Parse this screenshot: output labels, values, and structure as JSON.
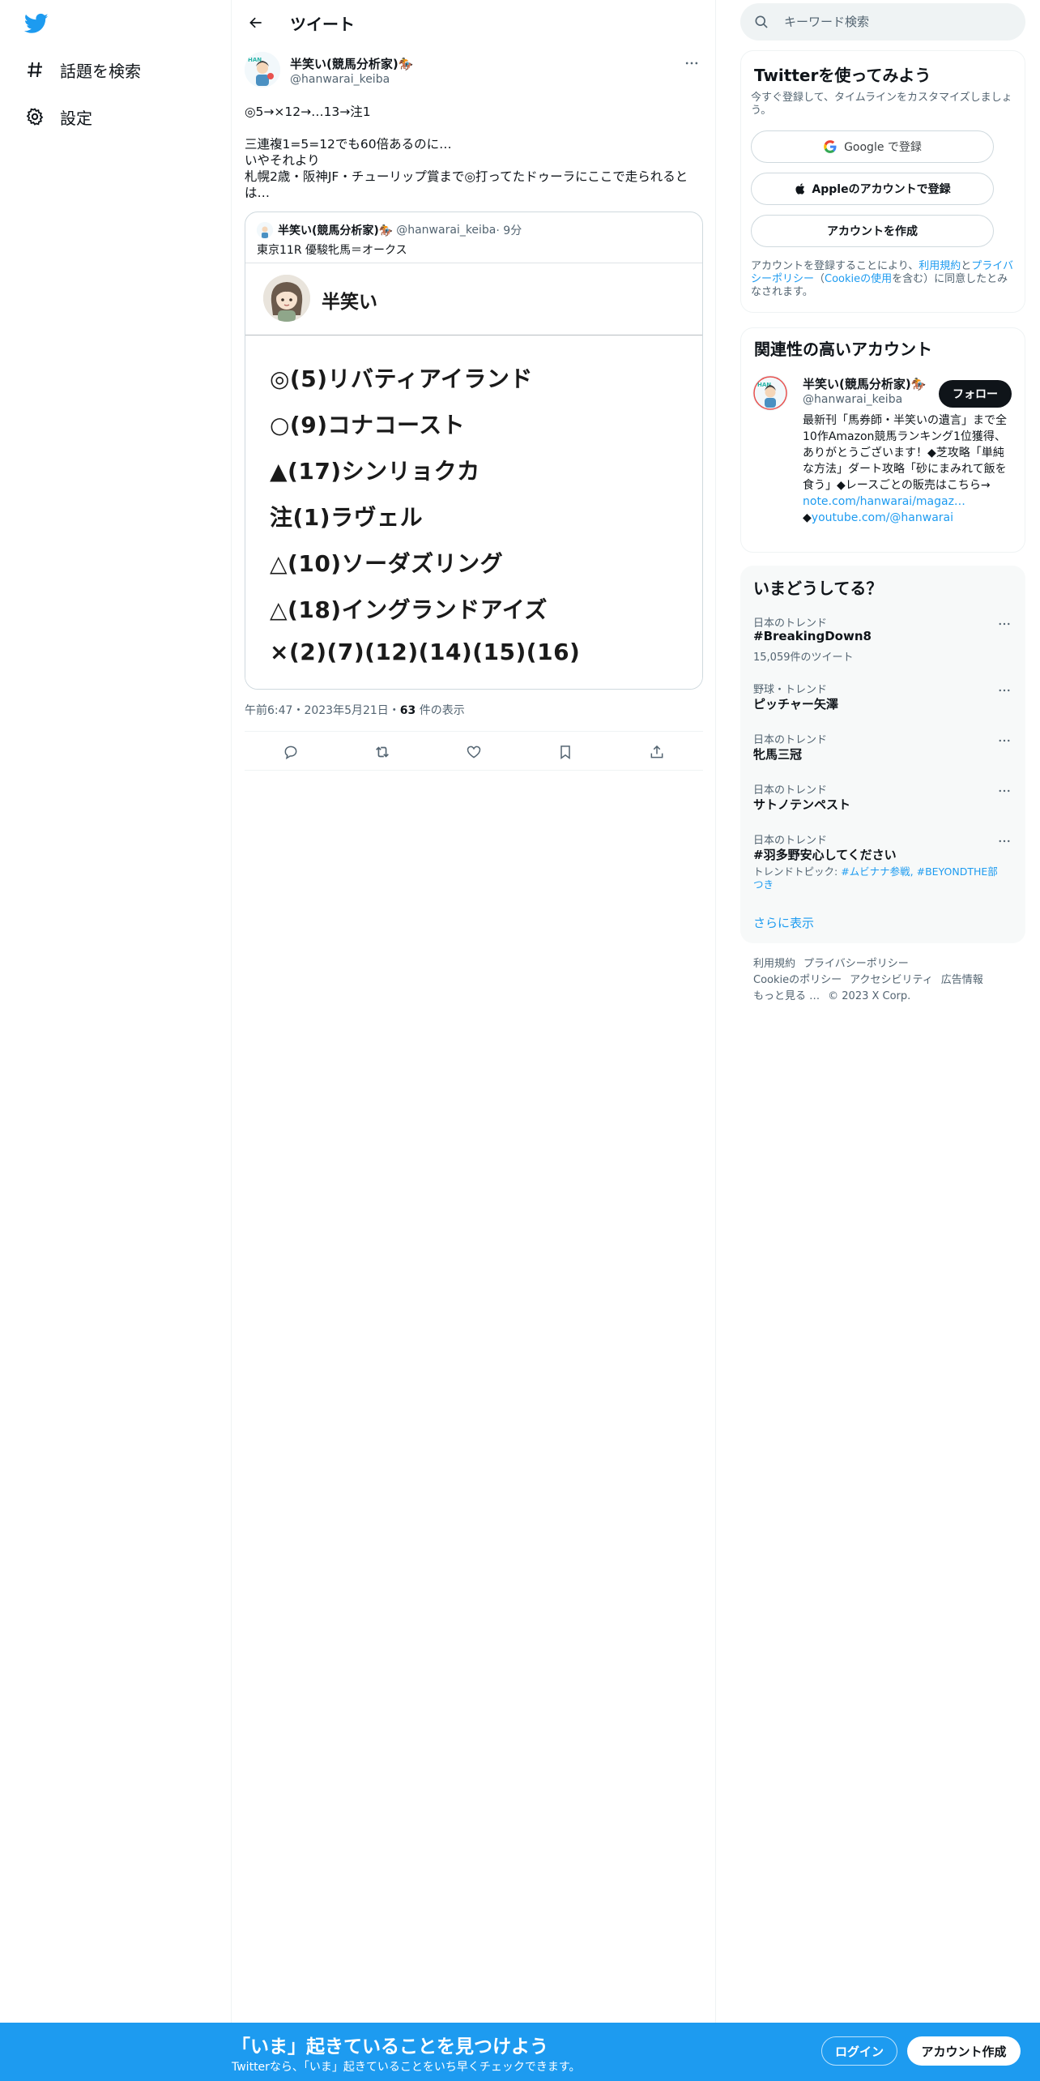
{
  "sidebar": {
    "items": [
      {
        "label": "話題を検索",
        "icon": "hashtag-icon"
      },
      {
        "label": "設定",
        "icon": "gear-icon"
      }
    ]
  },
  "header": {
    "title": "ツイート"
  },
  "tweet": {
    "author_name": "半笑い(競馬分析家)🏇",
    "author_handle": "@hanwarai_keiba",
    "lines": [
      "◎5→×12→…13→注1",
      "",
      "三連複1=5=12でも60倍あるのに…",
      "いやそれより",
      "札幌2歳・阪神JF・チューリップ賞まで◎打ってたドゥーラにここで走られるとは…"
    ],
    "timestamp": "午前6:47・2023年5月21日・",
    "views_count": "63",
    "views_label": " 件の表示"
  },
  "quote": {
    "author_name": "半笑い(競馬分析家)🏇",
    "author_handle": "@hanwarai_keiba",
    "time": " · 9分",
    "text": "東京11R 優駿牝馬＝オークス",
    "image": {
      "name": "半笑い",
      "picks": [
        "◎(5)リバティアイランド",
        "○(9)コナコースト",
        "▲(17)シンリョクカ",
        "注(1)ラヴェル",
        "△(10)ソーダズリング",
        "△(18)イングランドアイズ",
        "×(2)(7)(12)(14)(15)(16)"
      ]
    }
  },
  "search": {
    "placeholder": "キーワード検索"
  },
  "signup_card": {
    "title": "Twitterを使ってみよう",
    "subtitle": "今すぐ登録して、タイムラインをカスタマイズしましょう。",
    "google_label": "Google で登録",
    "apple_label": "Appleのアカウントで登録",
    "create_label": "アカウントを作成",
    "legal_prefix": "アカウントを登録することにより、",
    "legal_terms": "利用規約",
    "legal_and": "と",
    "legal_privacy": "プライバシーポリシー",
    "legal_paren_open": "（",
    "legal_cookie": "Cookieの使用",
    "legal_suffix": "を含む）に同意したとみなされます。"
  },
  "relevant": {
    "title": "関連性の高いアカウント",
    "name": "半笑い(競馬分析家)🏇",
    "handle": "@hanwarai_keiba",
    "follow_label": "フォロー",
    "bio": "最新刊「馬券師・半笑いの遺言」まで全10作Amazon競馬ランキング1位獲得、ありがとうございます！◆芝攻略「単純な方法」ダート攻略「砂にまみれて飯を食う」◆レースごとの販売はこちら→",
    "link1": "note.com/hanwarai/magaz…",
    "link2_prefix": "◆",
    "link2": "youtube.com/@hanwarai"
  },
  "trends": {
    "title": "いまどうしてる？",
    "items": [
      {
        "category": "日本のトレンド",
        "name": "#BreakingDown8",
        "count": "15,059件のツイート"
      },
      {
        "category": "野球・トレンド",
        "name": "ピッチャー矢澤",
        "count": ""
      },
      {
        "category": "日本のトレンド",
        "name": "牝馬三冠",
        "count": ""
      },
      {
        "category": "日本のトレンド",
        "name": "サトノテンペスト",
        "count": ""
      },
      {
        "category": "日本のトレンド",
        "name": "#羽多野安心してください",
        "count": ""
      }
    ],
    "topic_prefix": "トレンドトピック: ",
    "topic_links": "#ムビナナ参戦, #BEYONDTHE部",
    "topic_suffix": "つき",
    "show_more": "さらに表示"
  },
  "footer": {
    "links": [
      "利用規約",
      "プライバシーポリシー",
      "Cookieのポリシー",
      "アクセシビリティ",
      "広告情報",
      "もっと見る …",
      "© 2023 X Corp."
    ]
  },
  "banner": {
    "title": "「いま」起きていることを見つけよう",
    "subtitle": "Twitterなら、「いま」起きていることをいち早くチェックできます。",
    "login_label": "ログイン",
    "signup_label": "アカウント作成"
  },
  "colors": {
    "accent": "#1d9bf0",
    "text": "#0f1419",
    "secondary": "#536471"
  }
}
